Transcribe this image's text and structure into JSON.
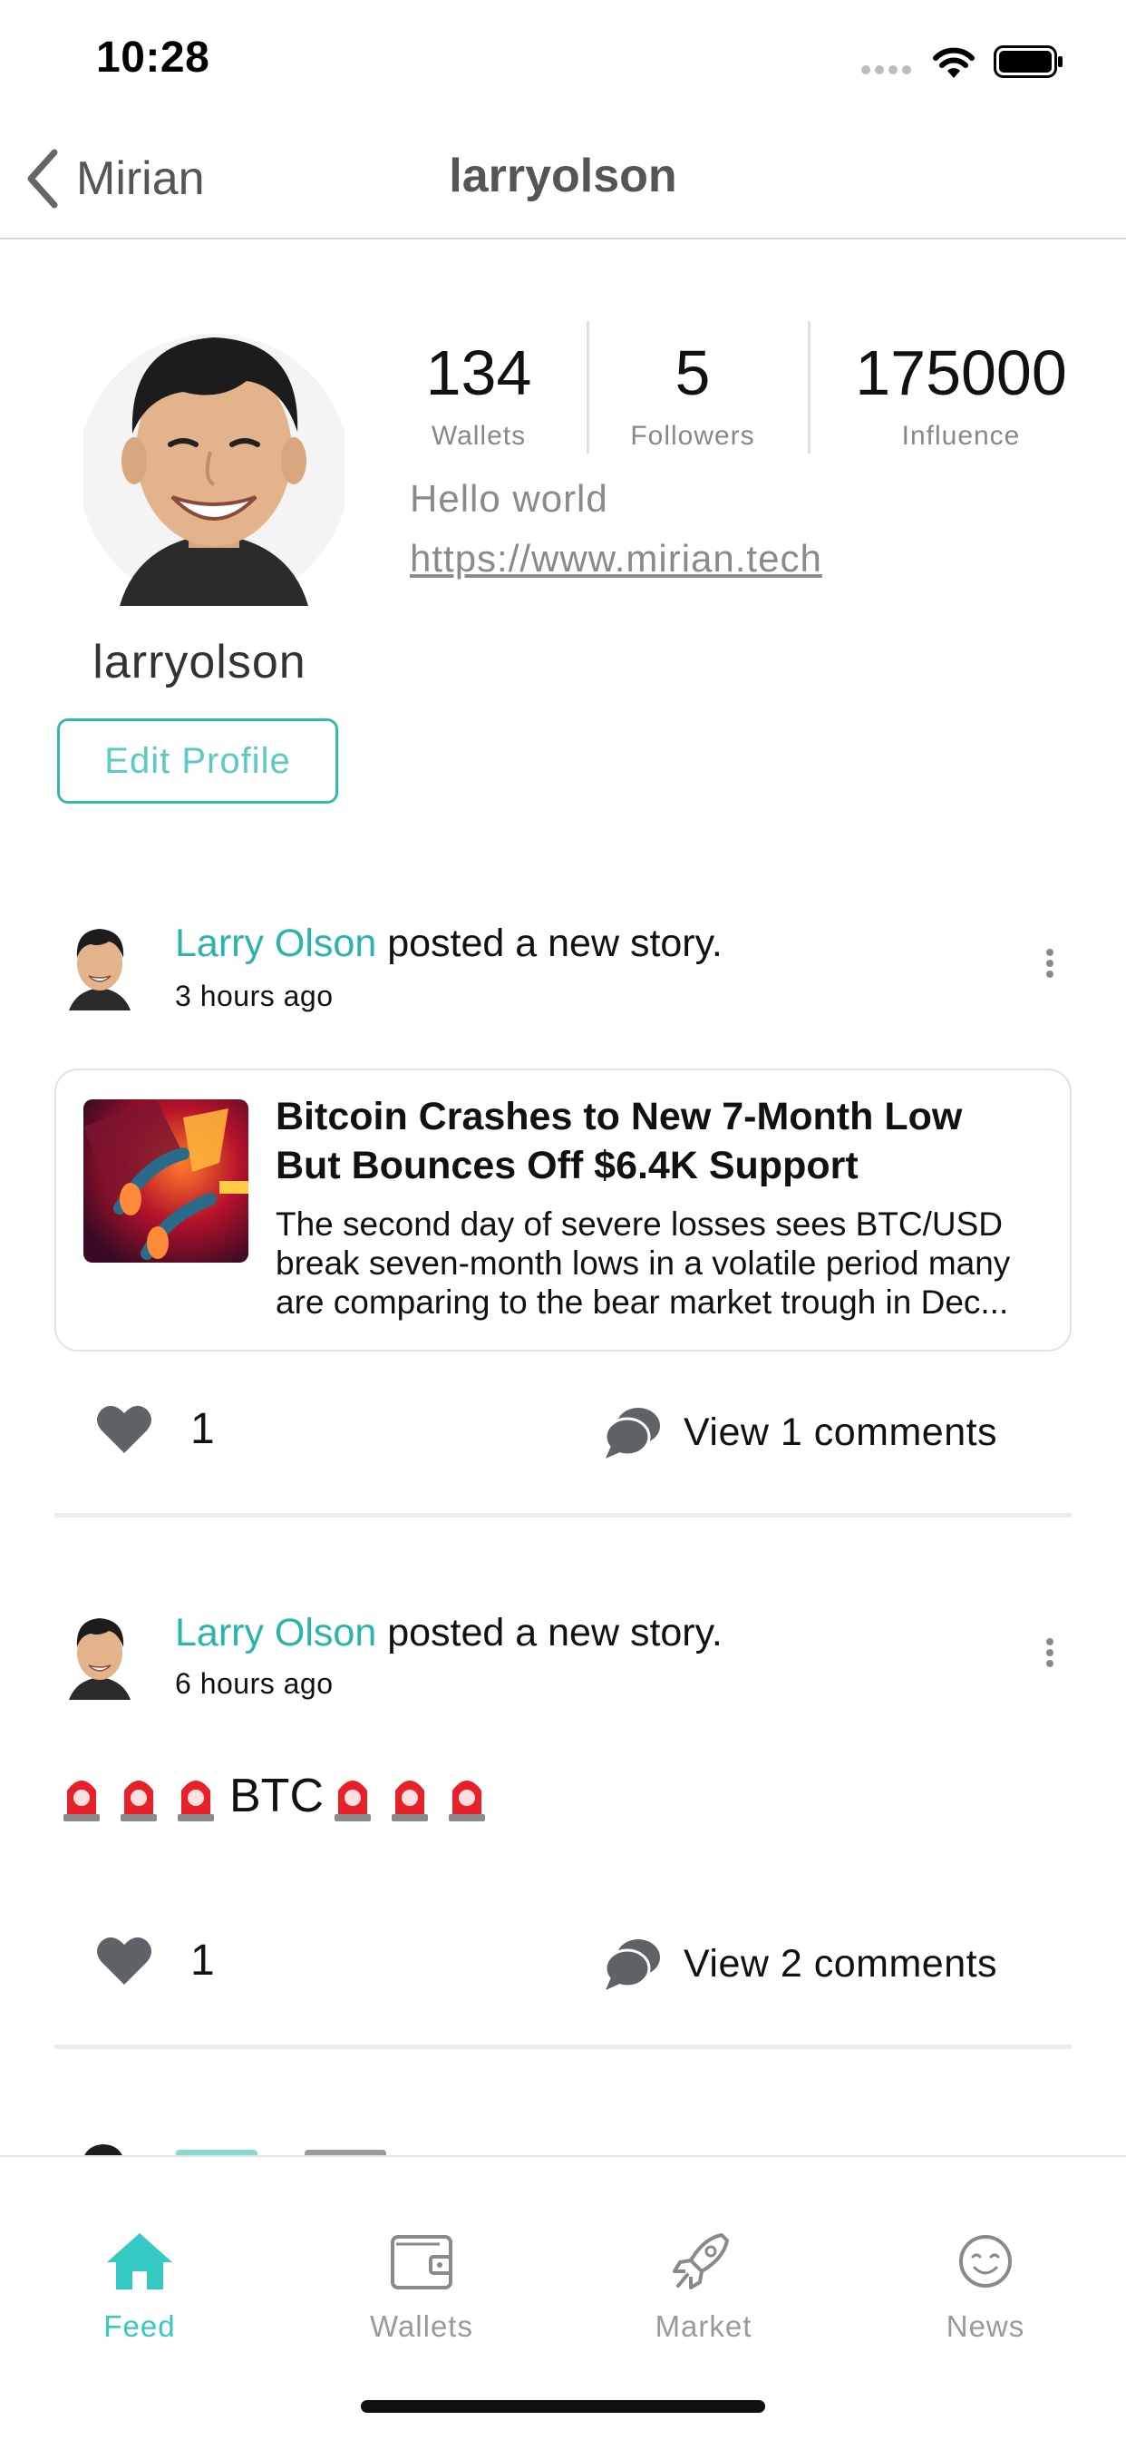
{
  "status_bar": {
    "time": "10:28"
  },
  "nav": {
    "back_label": "Mirian",
    "title": "larryolson"
  },
  "profile": {
    "username": "larryolson",
    "edit_label": "Edit Profile",
    "stats": [
      {
        "value": "134",
        "label": "Wallets"
      },
      {
        "value": "5",
        "label": "Followers"
      },
      {
        "value": "175000",
        "label": "Influence"
      }
    ],
    "bio": "Hello world",
    "link": "https://www.mirian.tech"
  },
  "posts": [
    {
      "author": "Larry Olson",
      "action": " posted a new story.",
      "time": "3 hours ago",
      "story": {
        "title": "Bitcoin Crashes to New 7-Month Low But Bounces Off $6.4K Support",
        "description": "The second day of severe losses sees BTC/USD break seven-month lows in a volatile period many are comparing to the bear market trough in Dec..."
      },
      "likes": "1",
      "comments_label": "View 1 comments"
    },
    {
      "author": "Larry Olson",
      "action": " posted a new story.",
      "time": "6 hours ago",
      "text": "BTC",
      "likes": "1",
      "comments_label": "View 2 comments"
    }
  ],
  "tabs": [
    {
      "label": "Feed",
      "icon": "home-icon",
      "active": true
    },
    {
      "label": "Wallets",
      "icon": "wallet-icon",
      "active": false
    },
    {
      "label": "Market",
      "icon": "rocket-icon",
      "active": false
    },
    {
      "label": "News",
      "icon": "smile-icon",
      "active": false
    }
  ],
  "colors": {
    "accent": "#35c9c4",
    "author": "#2bb3ad",
    "icon_gray": "#5f6368"
  }
}
